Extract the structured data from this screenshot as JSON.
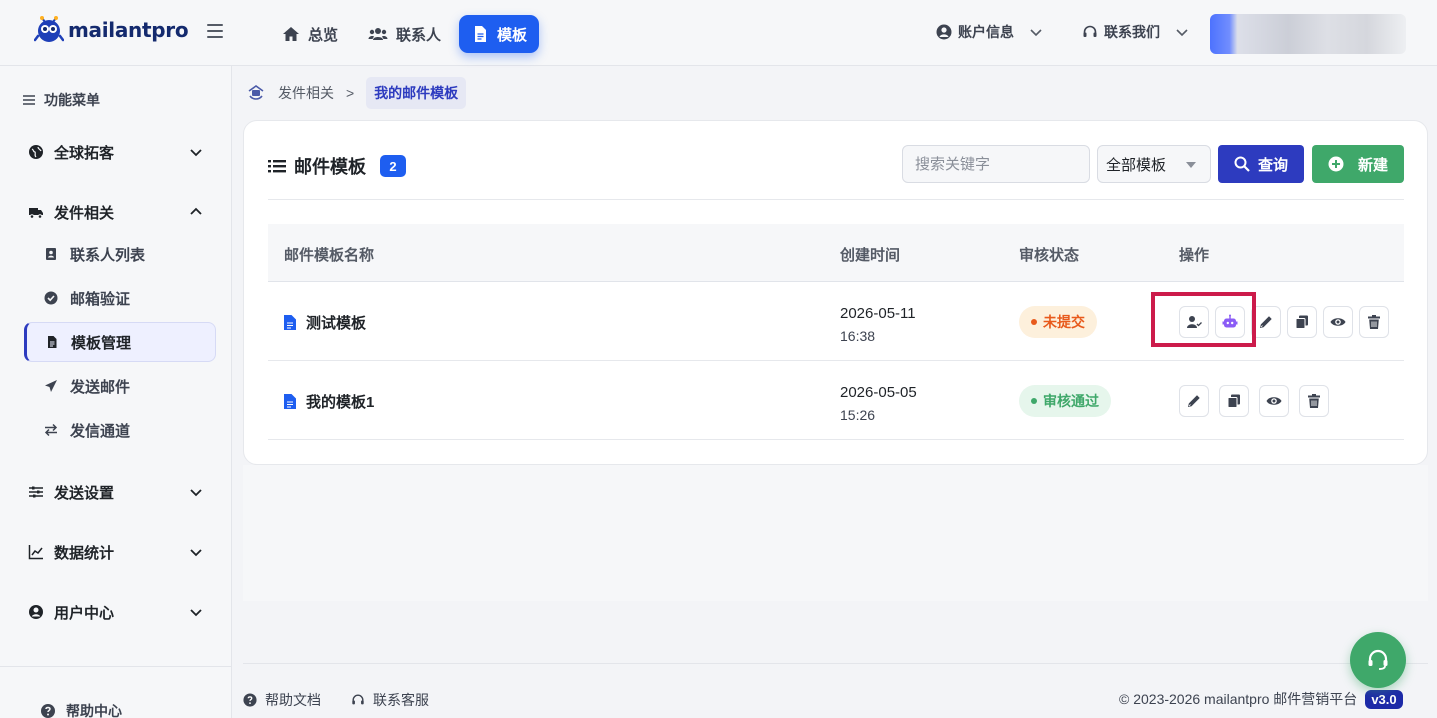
{
  "app": {
    "brand": "mailantpro",
    "accent": "#1e5ef0",
    "primary_dark": "#2d3bbf",
    "success": "#3fa86a",
    "warning": "#e85a1c"
  },
  "topnav": {
    "items": [
      {
        "label": "总览",
        "icon": "home-icon"
      },
      {
        "label": "联系人",
        "icon": "users-icon"
      },
      {
        "label": "模板",
        "icon": "document-icon",
        "active": true
      }
    ],
    "account": "账户信息",
    "contact": "联系我们"
  },
  "sidebar": {
    "header": "功能菜单",
    "groups": [
      {
        "label": "全球拓客",
        "icon": "globe-icon",
        "expanded": false
      },
      {
        "label": "发件相关",
        "icon": "truck-icon",
        "expanded": true
      },
      {
        "label": "发送设置",
        "icon": "sliders-icon",
        "expanded": false
      },
      {
        "label": "数据统计",
        "icon": "chart-line-icon",
        "expanded": false
      },
      {
        "label": "用户中心",
        "icon": "user-circle-icon",
        "expanded": false
      }
    ],
    "sub_items": [
      {
        "label": "联系人列表",
        "icon": "address-book-icon"
      },
      {
        "label": "邮箱验证",
        "icon": "check-circle-icon"
      },
      {
        "label": "模板管理",
        "icon": "document-icon",
        "active": true
      },
      {
        "label": "发送邮件",
        "icon": "paper-plane-icon"
      },
      {
        "label": "发信通道",
        "icon": "exchange-icon"
      }
    ],
    "help": "帮助中心"
  },
  "breadcrumb": {
    "parent": "发件相关",
    "separator": ">",
    "current": "我的邮件模板"
  },
  "card": {
    "title": "邮件模板",
    "count": "2",
    "search_placeholder": "搜索关键字",
    "filter_value": "全部模板",
    "query_label": "查询",
    "new_label": "新建"
  },
  "table": {
    "columns": [
      "邮件模板名称",
      "创建时间",
      "审核状态",
      "操作"
    ],
    "rows": [
      {
        "name": "测试模板",
        "date": "2026-05-11",
        "time": "16:38",
        "status": "未提交",
        "status_kind": "pending",
        "actions": [
          "assign-user-icon",
          "robot-icon",
          "edit-icon",
          "copy-icon",
          "view-icon",
          "delete-icon"
        ]
      },
      {
        "name": "我的模板1",
        "date": "2026-05-05",
        "time": "15:26",
        "status": "审核通过",
        "status_kind": "approved",
        "actions": [
          "edit-icon",
          "copy-icon",
          "view-icon",
          "delete-icon"
        ]
      }
    ]
  },
  "footer": {
    "docs": "帮助文档",
    "support": "联系客服",
    "copyright": "© 2023-2026 mailantpro 邮件营销平台",
    "version": "v3.0"
  }
}
